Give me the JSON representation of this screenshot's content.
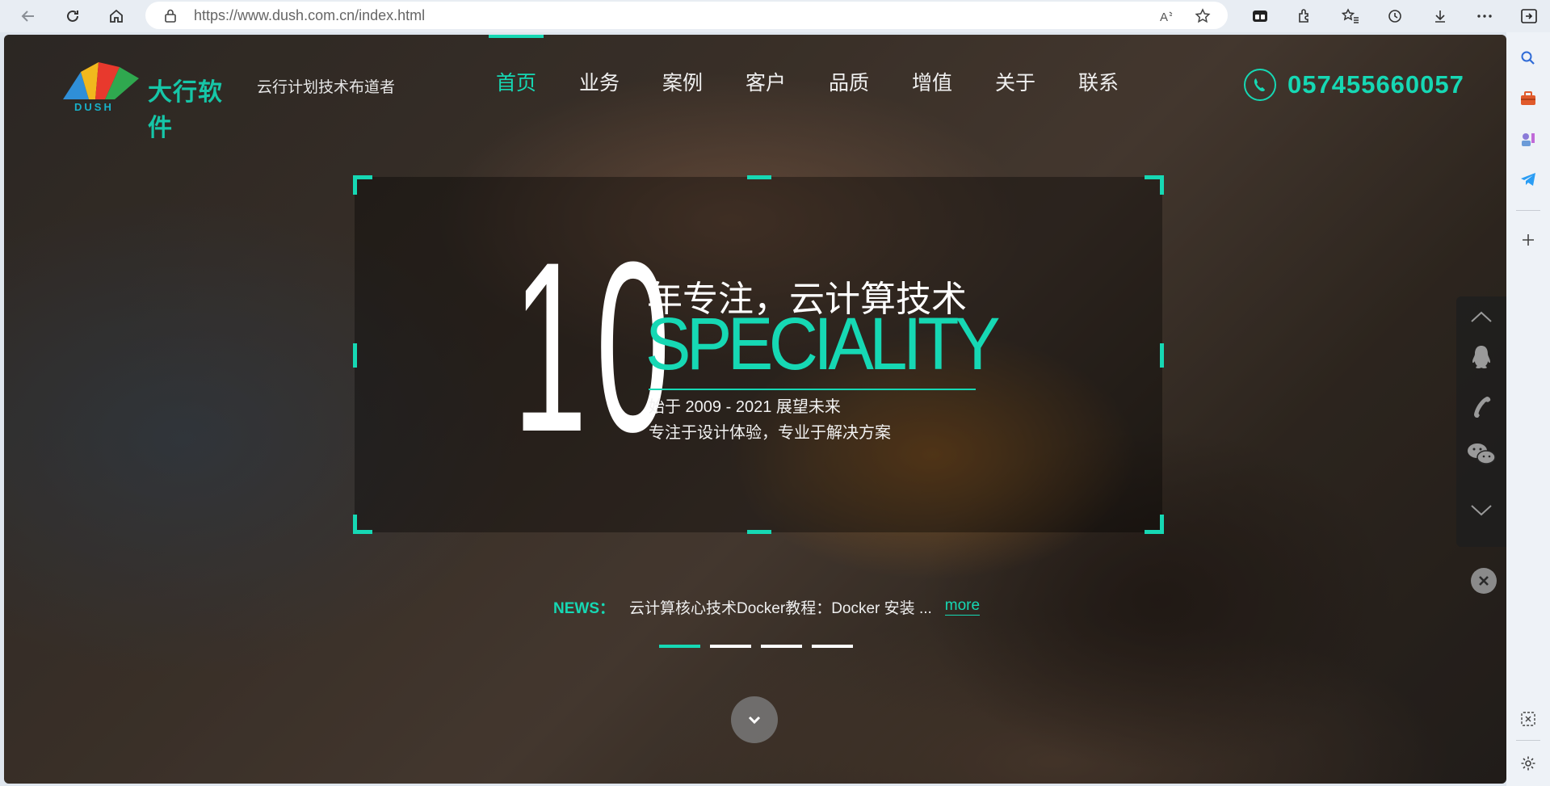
{
  "browser": {
    "url_host": "https://www.dush.com.cn",
    "url_path": "/index.html"
  },
  "site": {
    "logo_text": "大行软件",
    "logo_sub": "DUSH",
    "tagline": "云行计划技术布道者",
    "nav": [
      "首页",
      "业务",
      "案例",
      "客户",
      "品质",
      "增值",
      "关于",
      "联系"
    ],
    "active_nav": "首页",
    "phone": "05745566005​7"
  },
  "hero": {
    "big_number": "10",
    "title": "年专注，云计算技术",
    "speciality": "SPECIALITY",
    "subtitle_1": "始于 2009 - 2021 展望未来",
    "subtitle_2": "专注于设计体验，专业于解决方案"
  },
  "news": {
    "label": "NEWS：",
    "text": "云计算核心技术Docker教程：Docker 安装 ...",
    "more": "more"
  },
  "slider": {
    "count": 4,
    "active_index": 0
  },
  "colors": {
    "accent": "#16d8b4",
    "chrome": "#e8edf3"
  }
}
